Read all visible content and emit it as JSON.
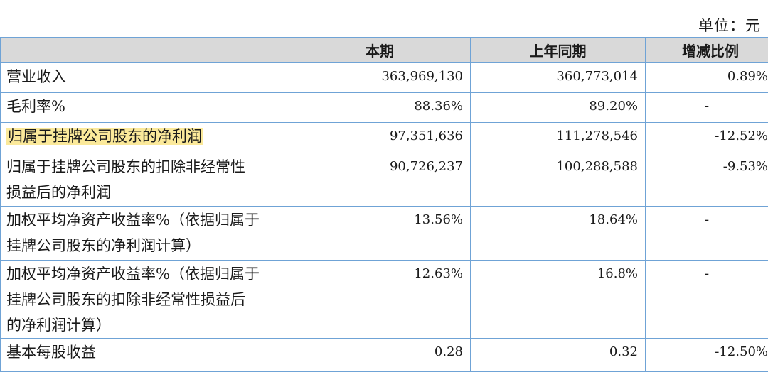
{
  "unit_label": "单位：元",
  "headers": [
    "",
    "本期",
    "上年同期",
    "增减比例"
  ],
  "rows": [
    {
      "label": "营业收入",
      "current": "363,969,130",
      "previous": "360,773,014",
      "change": "0.89%"
    },
    {
      "label": "毛利率%",
      "current": "88.36%",
      "previous": "89.20%",
      "change": "-"
    },
    {
      "label": "归属于挂牌公司股东的净利润",
      "current": "97,351,636",
      "previous": "111,278,546",
      "change": "-12.52%",
      "highlighted": true
    },
    {
      "label_lines": [
        "归属于挂牌公司股东的扣除非经常性",
        "损益后的净利润"
      ],
      "current": "90,726,237",
      "previous": "100,288,588",
      "change": "-9.53%"
    },
    {
      "label_lines": [
        "加权平均净资产收益率%（依据归属于",
        "挂牌公司股东的净利润计算）"
      ],
      "current": "13.56%",
      "previous": "18.64%",
      "change": "-"
    },
    {
      "label_lines": [
        "加权平均净资产收益率%（依据归属于",
        "挂牌公司股东的扣除非经常性损益后",
        "的净利润计算）"
      ],
      "current": "12.63%",
      "previous": "16.8%",
      "change": "-"
    },
    {
      "label": "基本每股收益",
      "current": "0.28",
      "previous": "0.32",
      "change": "-12.50%"
    }
  ],
  "colors": {
    "border": "#6fa3d6",
    "header_bg": "#d9d9d9",
    "highlight": "#fbe99a"
  }
}
